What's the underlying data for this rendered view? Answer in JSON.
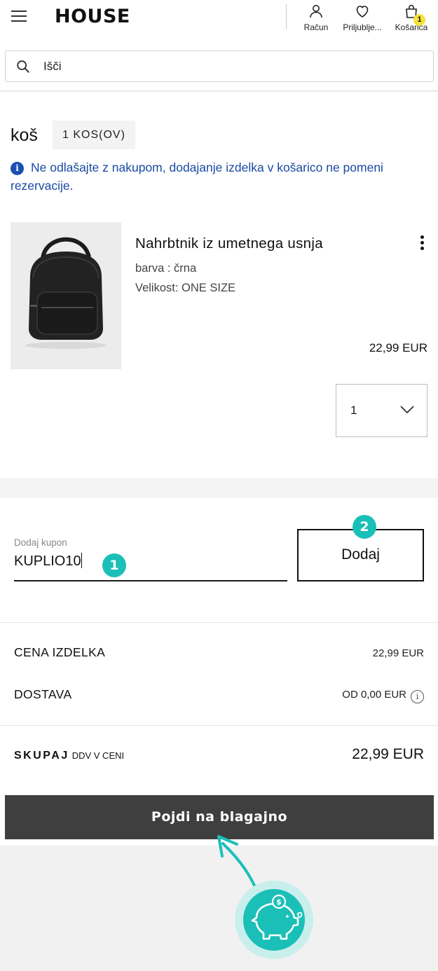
{
  "header": {
    "logo": "HOUSE",
    "nav": [
      {
        "label": "Račun",
        "icon": "user-icon"
      },
      {
        "label": "Priljublje...",
        "icon": "heart-icon"
      },
      {
        "label": "Košarica",
        "icon": "bag-icon",
        "badge": "1"
      }
    ],
    "search": {
      "placeholder": "Išči"
    }
  },
  "cart": {
    "title": "koš",
    "count": "1 KOS(OV)",
    "notice": "Ne odlašajte z nakupom, dodajanje izdelka v košarico ne pomeni rezervacije.",
    "item": {
      "name": "Nahrbtnik iz umetnega usnja",
      "color": "barva : črna",
      "size": "Velikost: ONE SIZE",
      "price": "22,99 EUR",
      "quantity": "1"
    }
  },
  "coupon": {
    "label": "Dodaj kupon",
    "value": "KUPLIO10",
    "button": "Dodaj",
    "step1": "1",
    "step2": "2"
  },
  "summary": {
    "item_price_label": "CENA IZDELKA",
    "item_price": "22,99 EUR",
    "shipping_label": "DOSTAVA",
    "shipping": "OD 0,00 EUR",
    "total_label": "SKUPAJ",
    "total_note": "DDV V CENI",
    "total": "22,99 EUR",
    "checkout": "Pojdi na blagajno"
  },
  "colors": {
    "accent_teal": "#1ac0b8",
    "notice_blue": "#1a4aa3",
    "badge_yellow": "#f5e33a",
    "checkout_bg": "#3f3f3f"
  }
}
